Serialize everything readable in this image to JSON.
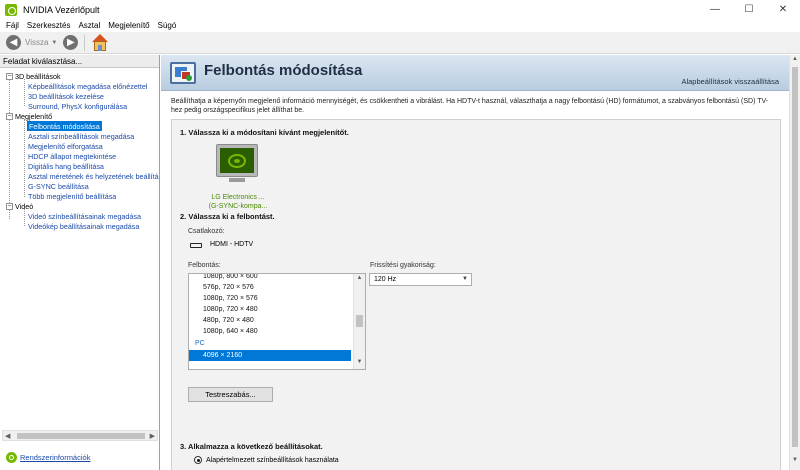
{
  "window": {
    "title": "NVIDIA Vezérlőpult",
    "controls": {
      "minimize": "—",
      "maximize": "☐",
      "close": "✕"
    }
  },
  "menu": {
    "items": [
      "Fájl",
      "Szerkesztés",
      "Asztal",
      "Megjelenítő",
      "Súgó"
    ]
  },
  "toolbar": {
    "back_label": "Vissza",
    "back_glyph": "◀",
    "forward_glyph": "▶",
    "caret": "▼"
  },
  "sidebar": {
    "header": "Feladat kiválasztása...",
    "categories": [
      {
        "label": "3D beállítások",
        "children": [
          "Képbeállítások megadása előnézettel",
          "3D beállítások kezelése",
          "Surround, PhysX konfigurálása"
        ]
      },
      {
        "label": "Megjelenítő",
        "children": [
          "Felbontás módosítása",
          "Asztali színbeállítások megadása",
          "Megjelenítő elforgatása",
          "HDCP állapot megtekintése",
          "Digitális hang beállítása",
          "Asztal méretének és helyzetének beállítása",
          "G-SYNC beállítása",
          "Több megjelenítő beállítása"
        ]
      },
      {
        "label": "Videó",
        "children": [
          "Videó színbeállításainak megadása",
          "Videókép beállításainak megadása"
        ]
      }
    ],
    "selected": "Felbontás módosítása",
    "expander_symbol": "−",
    "system_info": "Rendszerinformációk",
    "scroll_left": "◀",
    "scroll_right": "▶"
  },
  "main": {
    "title": "Felbontás módosítása",
    "restore_defaults": "Alapbeállítások visszaállítása",
    "description": "Beállíthatja a képernyőn megjelenő információ mennyiségét, és csökkentheti a vibrálást. Ha HDTV-t használ, választhatja a nagy felbontású (HD) formátumot, a szabványos felbontású (SD) TV-hez pedig országspecifikus jelet állíthat be.",
    "step1": "1. Válassza ki a módosítani kívánt megjelenítőt.",
    "display_name_line1": "LG Electronics ...",
    "display_name_line2": "(G-SYNC-kompa...",
    "step2": "2. Válassza ki a felbontást.",
    "connector_label": "Csatlakozó:",
    "connector_value": "HDMI - HDTV",
    "resolution_label": "Felbontás:",
    "resolutions": [
      "1080p, 800 × 600",
      "576p, 720 × 576",
      "1080p, 720 × 576",
      "1080p, 720 × 480",
      "480p, 720 × 480",
      "1080p, 640 × 480"
    ],
    "resolution_group": "PC",
    "resolution_selected": "4096 × 2160",
    "refresh_label": "Frissítési gyakoriság:",
    "refresh_value": "120 Hz",
    "customize_button": "Testreszabás...",
    "step3": "3. Alkalmazza a következő beállításokat.",
    "radio_default": "Alapértelmezett színbeállítások használata",
    "scroll_up": "▲",
    "scroll_down": "▼"
  }
}
